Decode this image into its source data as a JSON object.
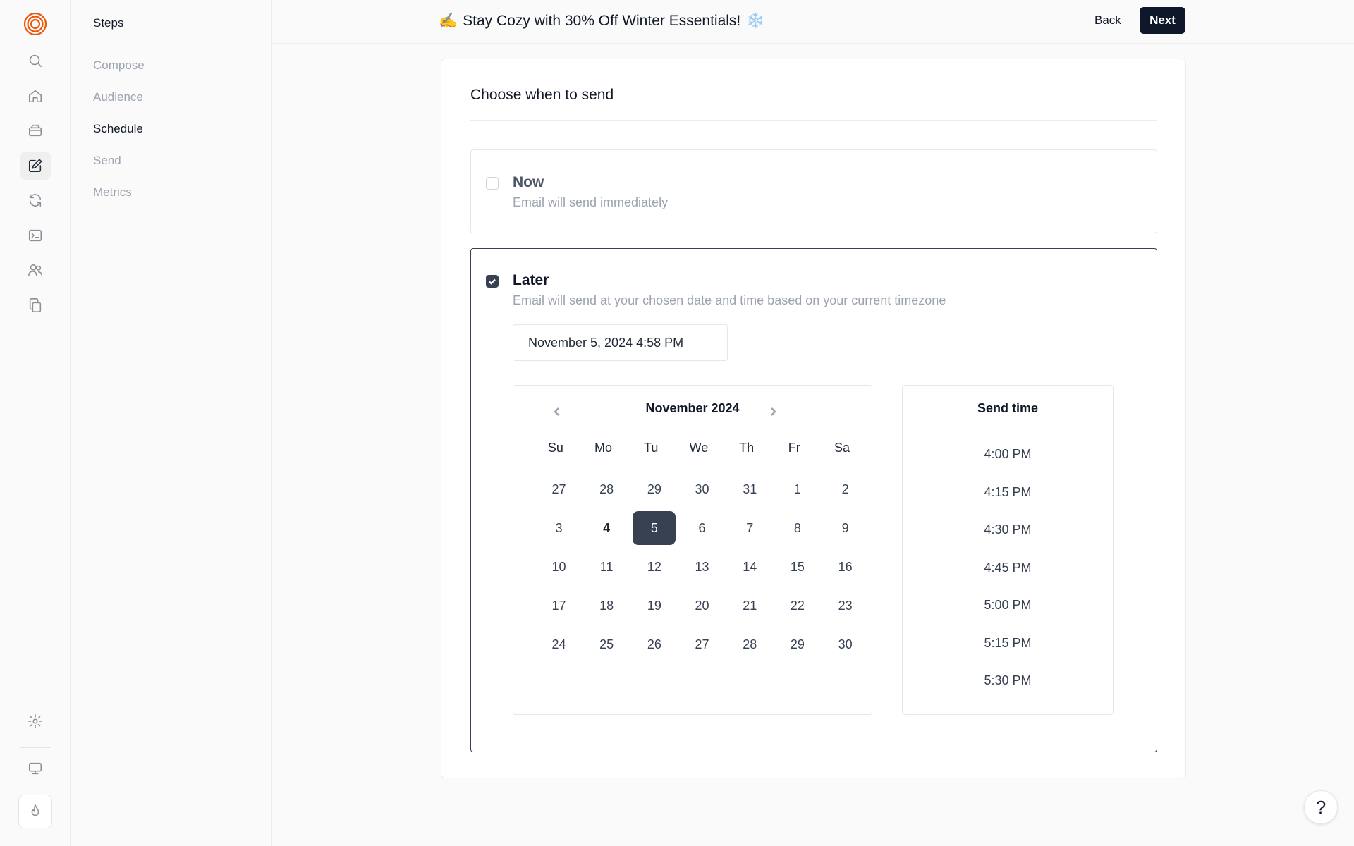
{
  "header": {
    "subject_emoji": "✍️",
    "subject": "Stay Cozy with 30% Off Winter Essentials!",
    "subject_trailing_emoji": "❄️",
    "back_label": "Back",
    "next_label": "Next"
  },
  "rail": {
    "icons": [
      "logo-icon",
      "search-icon",
      "home-icon",
      "inbox-icon",
      "edit-icon",
      "refresh-icon",
      "terminal-icon",
      "users-icon",
      "copy-icon",
      "settings-icon",
      "monitor-icon",
      "flame-icon"
    ],
    "active": "edit-icon"
  },
  "steps": {
    "title": "Steps",
    "items": [
      {
        "label": "Compose"
      },
      {
        "label": "Audience"
      },
      {
        "label": "Schedule"
      },
      {
        "label": "Send"
      },
      {
        "label": "Metrics"
      }
    ],
    "current": "Schedule"
  },
  "schedule": {
    "heading": "Choose when to send",
    "now": {
      "title": "Now",
      "description": "Email will send immediately",
      "checked": false
    },
    "later": {
      "title": "Later",
      "description": "Email will send at your chosen date and time based on your current timezone",
      "checked": true
    },
    "datetime_value": "November 5, 2024 4:58 PM",
    "calendar": {
      "month_label": "November 2024",
      "weekdays": [
        "Su",
        "Mo",
        "Tu",
        "We",
        "Th",
        "Fr",
        "Sa"
      ],
      "weeks": [
        [
          "27",
          "28",
          "29",
          "30",
          "31",
          "1",
          "2"
        ],
        [
          "3",
          "4",
          "5",
          "6",
          "7",
          "8",
          "9"
        ],
        [
          "10",
          "11",
          "12",
          "13",
          "14",
          "15",
          "16"
        ],
        [
          "17",
          "18",
          "19",
          "20",
          "21",
          "22",
          "23"
        ],
        [
          "24",
          "25",
          "26",
          "27",
          "28",
          "29",
          "30"
        ]
      ],
      "today": "4",
      "selected": "5"
    },
    "send_time": {
      "title": "Send time",
      "slots": [
        "4:00 PM",
        "4:15 PM",
        "4:30 PM",
        "4:45 PM",
        "5:00 PM",
        "5:15 PM",
        "5:30 PM"
      ]
    }
  },
  "help": {
    "label": "?"
  },
  "colors": {
    "accent": "#0f172a",
    "selected_day": "#374151",
    "logo": "#ea580c"
  }
}
